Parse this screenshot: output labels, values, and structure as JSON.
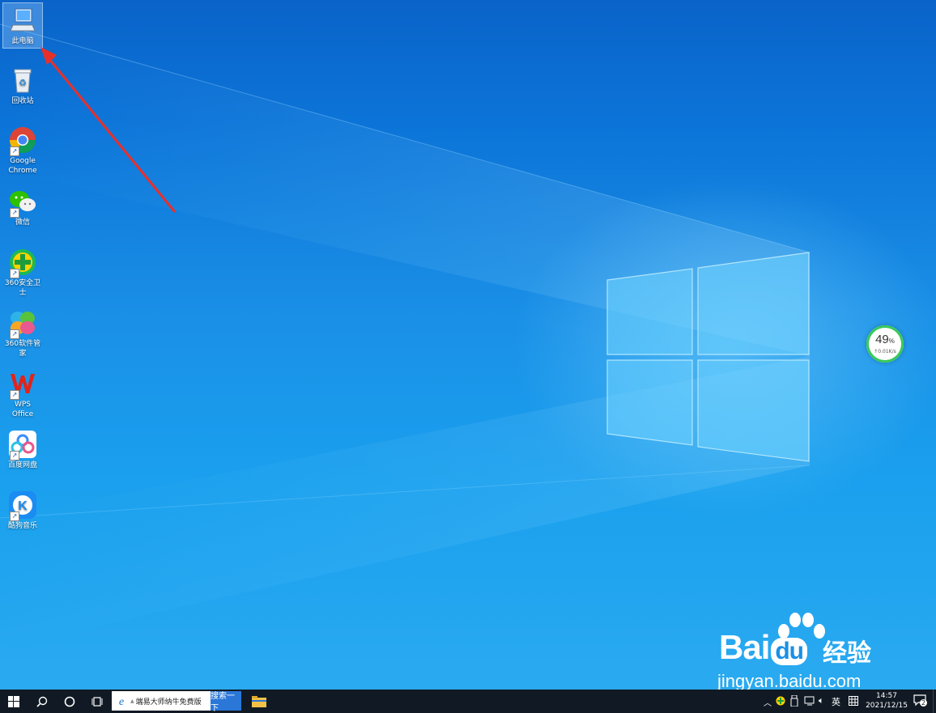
{
  "desktop": {
    "icons": [
      {
        "label": "此电脑",
        "icon": "computer-icon"
      },
      {
        "label": "回收站",
        "icon": "recycle-bin-icon"
      },
      {
        "label": "Google Chrome",
        "icon": "chrome-icon"
      },
      {
        "label": "微信",
        "icon": "wechat-icon"
      },
      {
        "label": "360安全卫士",
        "icon": "360-security-icon"
      },
      {
        "label": "360软件管家",
        "icon": "360-software-manager-icon"
      },
      {
        "label": "WPS Office",
        "icon": "wps-office-icon"
      },
      {
        "label": "百度网盘",
        "icon": "baidu-netdisk-icon"
      },
      {
        "label": "酷狗音乐",
        "icon": "kugou-music-icon"
      }
    ]
  },
  "widget": {
    "percent": "49",
    "percent_sign": "%",
    "rate": "↑0.01K/s"
  },
  "watermark": {
    "brand": "Bai",
    "du": "du",
    "jingyan": "经验",
    "url": "jingyan.baidu.com"
  },
  "taskbar": {
    "search_text": "端易大师纳牛免费版",
    "search_button": "搜索一下",
    "ime": "英",
    "time": "14:57",
    "date": "2021/12/15",
    "notification_count": "2"
  },
  "colors": {
    "arrow": "#e8302a",
    "taskbar": "#111a24",
    "accent": "#2a77d8"
  }
}
